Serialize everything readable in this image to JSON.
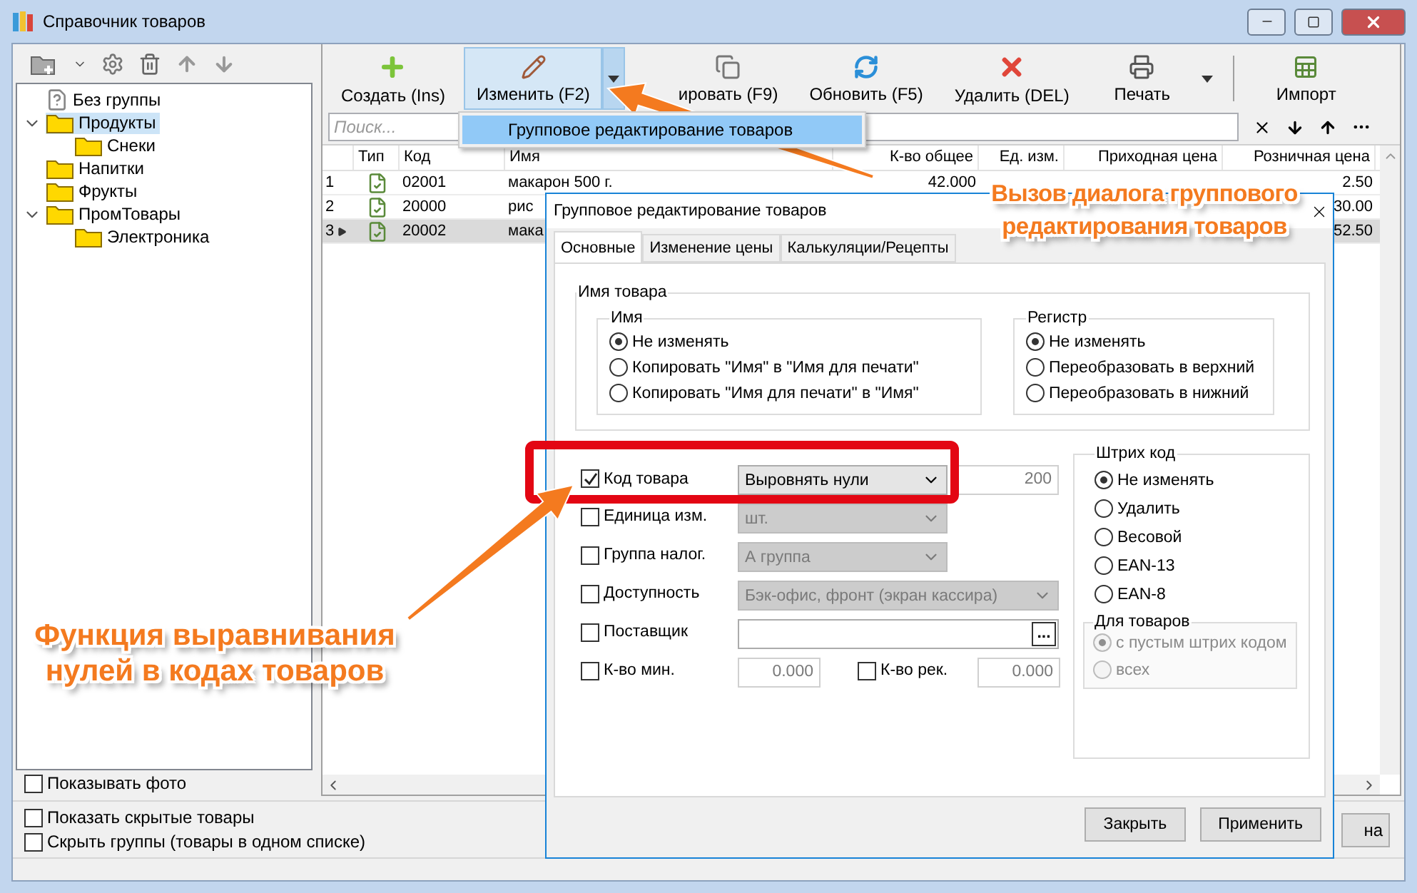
{
  "window": {
    "title": "Справочник товаров"
  },
  "tree": [
    {
      "label": "Без группы",
      "kind": "unknown",
      "selected": false
    },
    {
      "label": "Продукты",
      "kind": "folder",
      "selected": true,
      "expanded": true,
      "children": [
        {
          "label": "Снеки",
          "kind": "folder",
          "selected": false
        }
      ]
    },
    {
      "label": "Напитки",
      "kind": "folder",
      "selected": false
    },
    {
      "label": "Фрукты",
      "kind": "folder",
      "selected": false
    },
    {
      "label": "ПромТовары",
      "kind": "folder",
      "selected": false,
      "expanded": true,
      "children": [
        {
          "label": "Электроника",
          "kind": "folder",
          "selected": false
        }
      ]
    }
  ],
  "show_photo": {
    "label": "Показывать фото",
    "checked": false
  },
  "toolbar": [
    {
      "kind": "create",
      "label": "Создать (Ins)",
      "pressed": false,
      "dropdown": false
    },
    {
      "kind": "edit",
      "label": "Изменить (F2)",
      "pressed": true,
      "dropdown": true
    },
    {
      "kind": "copy",
      "label": "ировать (F9)",
      "pressed": false,
      "dropdown": false
    },
    {
      "kind": "refresh",
      "label": "Обновить (F5)",
      "pressed": false,
      "dropdown": false
    },
    {
      "kind": "delete",
      "label": "Удалить (DEL)",
      "pressed": false,
      "dropdown": false
    },
    {
      "kind": "print",
      "label": "Печать",
      "pressed": false,
      "dropdown": true
    },
    {
      "kind": "import",
      "label": "Импорт",
      "pressed": false,
      "dropdown": false
    }
  ],
  "edit_menu": {
    "items": [
      {
        "label": "Групповое редактирование товаров",
        "selected": true
      }
    ]
  },
  "search": {
    "placeholder": "Поиск..."
  },
  "table": {
    "columns": [
      "Тип",
      "Код",
      "Имя",
      "К-во общее",
      "Ед. изм.",
      "Приходная цена",
      "Розничная цена"
    ],
    "rows": [
      {
        "number": "1",
        "code": "02001",
        "name": "макарон 500 г.",
        "quantity": "42.000",
        "retail_price": "2.50",
        "selected": false
      },
      {
        "number": "2",
        "code": "20000",
        "name": "рис",
        "retail_price": "30.00",
        "selected": false
      },
      {
        "number": "3",
        "code": "20002",
        "name": "мака",
        "retail_price": "52.50",
        "selected": true
      }
    ]
  },
  "options": [
    {
      "label": "Показать скрытые товары",
      "checked": false
    },
    {
      "label": "Скрыть группы (товары в одном списке)",
      "checked": false
    }
  ],
  "hidden_button": {
    "label": "на"
  },
  "dialog": {
    "title": "Групповое редактирование товаров",
    "tabs": [
      {
        "label": "Основные",
        "selected": true
      },
      {
        "label": "Изменение цены",
        "selected": false
      },
      {
        "label": "Калькуляции/Рецепты",
        "selected": false
      }
    ],
    "name_group": {
      "title": "Имя товара",
      "name": {
        "title": "Имя",
        "options": [
          {
            "label": "Не изменять",
            "selected": true
          },
          {
            "label": "Копировать \"Имя\" в \"Имя для печати\"",
            "selected": false
          },
          {
            "label": "Копировать \"Имя для печати\" в \"Имя\"",
            "selected": false
          }
        ]
      },
      "case": {
        "title": "Регистр",
        "options": [
          {
            "label": "Не изменять",
            "selected": true
          },
          {
            "label": "Переобразовать в верхний",
            "selected": false
          },
          {
            "label": "Переобразовать в нижний",
            "selected": false
          }
        ]
      }
    },
    "fields": [
      {
        "kind": "select",
        "label": "Код товара",
        "checked": true,
        "value": "Выровнять нули",
        "disabled": false,
        "number": "200"
      },
      {
        "kind": "select",
        "label": "Единица изм.",
        "checked": false,
        "value": "шт.",
        "disabled": true
      },
      {
        "kind": "select",
        "label": "Группа налог.",
        "checked": false,
        "value": "А группа",
        "disabled": true
      },
      {
        "kind": "wide",
        "label": "Доступность",
        "checked": false,
        "value": "Бэк-офис, фронт (экран кассира)",
        "disabled": true
      },
      {
        "kind": "picker",
        "label": "Поставщик",
        "checked": false,
        "button": "..."
      }
    ],
    "quantities": [
      {
        "label": "К-во мин.",
        "checked": false,
        "value": "0.000"
      },
      {
        "label": "К-во рек.",
        "checked": false,
        "value": "0.000"
      }
    ],
    "barcode": {
      "title": "Штрих код",
      "options": [
        {
          "label": "Не изменять",
          "selected": true
        },
        {
          "label": "Удалить",
          "selected": false
        },
        {
          "label": "Весовой",
          "selected": false
        },
        {
          "label": "EAN-13",
          "selected": false
        },
        {
          "label": "EAN-8",
          "selected": false
        }
      ],
      "for_goods": {
        "title": "Для товаров",
        "disabled": true,
        "options": [
          {
            "label": "с пустым штрих кодом",
            "selected": true
          },
          {
            "label": "всех",
            "selected": false
          }
        ]
      }
    },
    "buttons": [
      "Закрыть",
      "Применить"
    ]
  },
  "annotations": [
    {
      "kind": "top",
      "text": "Вызов диалога группового редактирования товаров"
    },
    {
      "kind": "bottom",
      "text": "Функция выравнивания нулей в кодах товаров"
    }
  ]
}
